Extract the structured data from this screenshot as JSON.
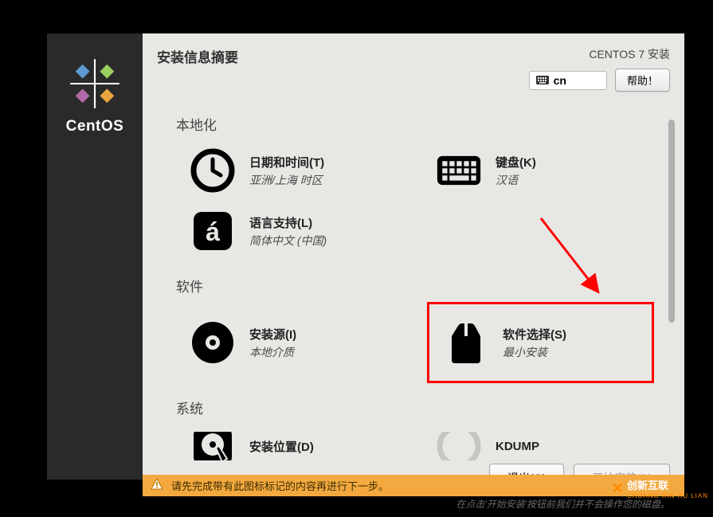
{
  "sidebar": {
    "brand": "CentOS"
  },
  "header": {
    "title": "安装信息摘要",
    "version": "CENTOS 7 安装",
    "lang": "cn",
    "help": "帮助！"
  },
  "sections": {
    "localization": {
      "label": "本地化",
      "datetime": {
        "title": "日期和时间(T)",
        "subtitle": "亚洲/上海 时区"
      },
      "keyboard": {
        "title": "键盘(K)",
        "subtitle": "汉语"
      },
      "language": {
        "title": "语言支持(L)",
        "subtitle": "简体中文 (中国)"
      }
    },
    "software": {
      "label": "软件",
      "installsource": {
        "title": "安装源(I)",
        "subtitle": "本地介质"
      },
      "softwaresel": {
        "title": "软件选择(S)",
        "subtitle": "最小安装"
      }
    },
    "system": {
      "label": "系统",
      "installdest": {
        "title": "安装位置(D)"
      },
      "kdump": {
        "title": "KDUMP"
      }
    }
  },
  "footer": {
    "quit": "退出(Q)",
    "begin": "开始安装(B)",
    "note": "在点击'开始安装'按钮前我们并不会操作您的磁盘。"
  },
  "warning": "请先完成带有此图标标记的内容再进行下一步。",
  "watermark": {
    "main": "创新互联",
    "sub": "CHUANG XIN HU LIAN"
  }
}
